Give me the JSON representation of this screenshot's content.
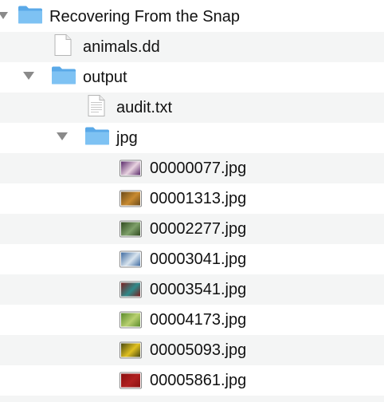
{
  "tree": {
    "root": {
      "name": "Recovering From the Snap",
      "icon": "folder-icon",
      "expanded": true
    },
    "animals": {
      "name": "animals.dd",
      "icon": "file-icon"
    },
    "output": {
      "name": "output",
      "icon": "folder-icon",
      "expanded": true
    },
    "audit": {
      "name": "audit.txt",
      "icon": "text-file-icon"
    },
    "jpg": {
      "name": "jpg",
      "icon": "folder-icon",
      "expanded": true
    },
    "images": [
      {
        "name": "00000077.jpg",
        "icon": "image-thumbnail-icon",
        "colors": [
          "#5a2a6a",
          "#e8d3e0"
        ]
      },
      {
        "name": "00001313.jpg",
        "icon": "image-thumbnail-icon",
        "colors": [
          "#6b4a1a",
          "#c88a30"
        ]
      },
      {
        "name": "00002277.jpg",
        "icon": "image-thumbnail-icon",
        "colors": [
          "#2f4a1f",
          "#7ea06a"
        ]
      },
      {
        "name": "00003041.jpg",
        "icon": "image-thumbnail-icon",
        "colors": [
          "#3e6aa0",
          "#d8e4ee"
        ]
      },
      {
        "name": "00003541.jpg",
        "icon": "image-thumbnail-icon",
        "colors": [
          "#7a1f1f",
          "#2f8a8a"
        ]
      },
      {
        "name": "00004173.jpg",
        "icon": "image-thumbnail-icon",
        "colors": [
          "#5a8a2a",
          "#b8d070"
        ]
      },
      {
        "name": "00005093.jpg",
        "icon": "image-thumbnail-icon",
        "colors": [
          "#4a4a10",
          "#e0c020"
        ]
      },
      {
        "name": "00005861.jpg",
        "icon": "image-thumbnail-icon",
        "colors": [
          "#8a1010",
          "#b02020"
        ]
      }
    ]
  },
  "colors": {
    "folder": "#7ec2f3",
    "folder_dark": "#5aa9e8",
    "row_alt": "#f4f5f5",
    "disclosure": "#8a8a8a"
  }
}
